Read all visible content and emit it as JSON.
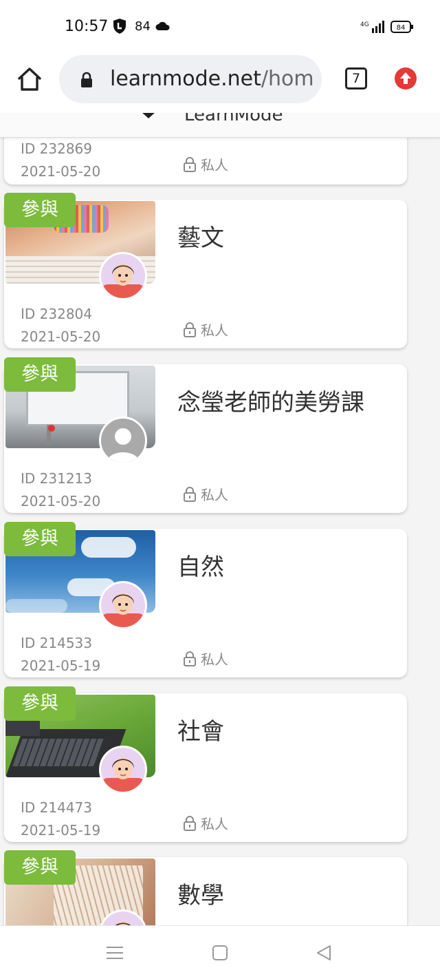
{
  "status": {
    "time": "10:57",
    "notif_count": "84",
    "network": "4G",
    "battery": "84"
  },
  "browser": {
    "url_host": "learnmode.net",
    "url_path": "/hom",
    "tab_count": "7"
  },
  "site": {
    "logo_text": "LearnMode"
  },
  "cards": [
    {
      "badge": "",
      "title": "",
      "id": "ID 232869",
      "date": "2021-05-20",
      "privacy": "私人"
    },
    {
      "badge": "參與",
      "title": "藝文",
      "id": "ID 232804",
      "date": "2021-05-20",
      "privacy": "私人"
    },
    {
      "badge": "參與",
      "title": "念瑩老師的美勞課",
      "id": "ID 231213",
      "date": "2021-05-20",
      "privacy": "私人"
    },
    {
      "badge": "參與",
      "title": "自然",
      "id": "ID 214533",
      "date": "2021-05-19",
      "privacy": "私人"
    },
    {
      "badge": "參與",
      "title": "社會",
      "id": "ID 214473",
      "date": "2021-05-19",
      "privacy": "私人"
    },
    {
      "badge": "參與",
      "title": "數學",
      "id": "",
      "date": "",
      "privacy": ""
    }
  ],
  "icons": {
    "shield": "shield-icon",
    "cloud": "cloud-icon",
    "home": "home-icon",
    "lock": "lock-icon",
    "tabs": "tabs-icon",
    "update": "update-icon",
    "padlock": "padlock-icon",
    "menu": "menu-icon",
    "square": "recents-icon",
    "back": "back-icon"
  },
  "colors": {
    "badge_green": "#7cbb3c",
    "update_red": "#e53935",
    "url_bg": "#eef0f3",
    "avatar_bg": "#e8d4f0"
  }
}
